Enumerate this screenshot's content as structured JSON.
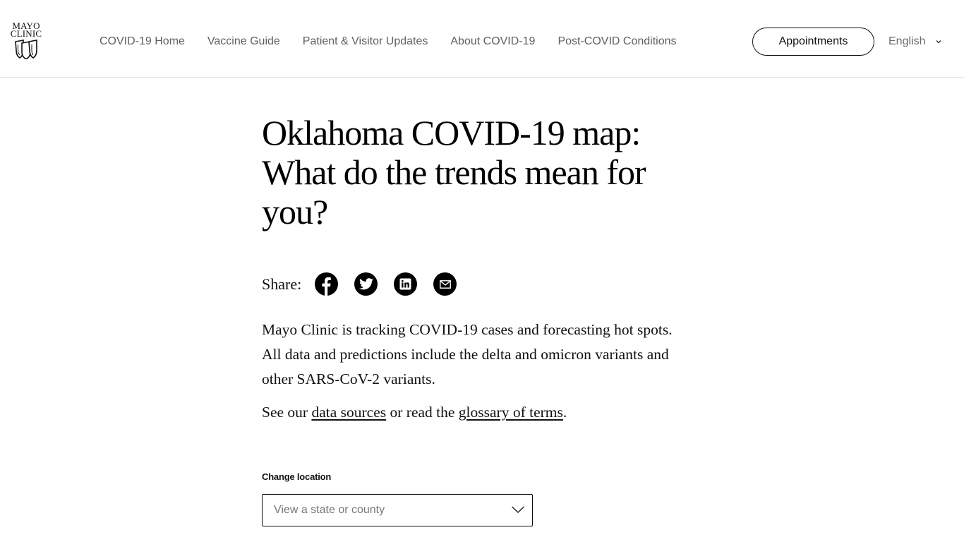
{
  "header": {
    "logo": {
      "line1": "MAYO",
      "line2": "CLINIC",
      "icon": "mayo-shields-icon"
    },
    "nav": [
      {
        "label": "COVID-19 Home"
      },
      {
        "label": "Vaccine Guide"
      },
      {
        "label": "Patient & Visitor Updates"
      },
      {
        "label": "About COVID-19"
      },
      {
        "label": "Post-COVID Conditions"
      }
    ],
    "appointments_label": "Appointments",
    "language": {
      "selected": "English",
      "icon": "chevron-down-icon"
    }
  },
  "main": {
    "title": "Oklahoma COVID-19 map: What do the trends mean for you?",
    "share": {
      "label": "Share:",
      "buttons": [
        {
          "icon": "facebook-icon"
        },
        {
          "icon": "twitter-icon"
        },
        {
          "icon": "linkedin-icon"
        },
        {
          "icon": "email-icon"
        }
      ]
    },
    "intro": "Mayo Clinic is tracking COVID-19 cases and forecasting hot spots. All data and predictions include the delta and omicron variants and other SARS-CoV-2 variants.",
    "sources": {
      "prefix": "See our ",
      "link1": "data sources",
      "middle": " or read the ",
      "link2": "glossary of terms",
      "suffix": "."
    },
    "location": {
      "label": "Change location",
      "placeholder": "View a state or county",
      "icon": "chevron-down-icon"
    }
  },
  "colors": {
    "nav_text": "#5f5f5f",
    "text": "#111111",
    "divider": "#e0e0e0",
    "icon_bg": "#000000"
  }
}
